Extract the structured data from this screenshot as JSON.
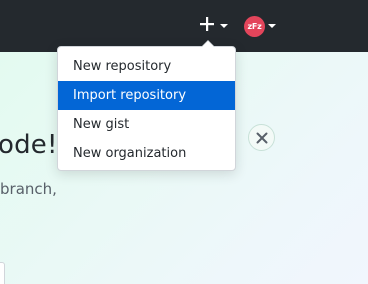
{
  "header": {
    "create_icon": "plus-icon",
    "avatar_text": "zFz",
    "avatar_color": "#e3455b"
  },
  "dropdown": {
    "items": [
      {
        "label": "New repository",
        "active": false
      },
      {
        "label": "Import repository",
        "active": true
      },
      {
        "label": "New gist",
        "active": false
      },
      {
        "label": "New organization",
        "active": false
      }
    ],
    "highlight_color": "#0366d6"
  },
  "main": {
    "heading_fragment": "ode!",
    "body_fragment": "branch,",
    "close_icon": "close-icon"
  }
}
